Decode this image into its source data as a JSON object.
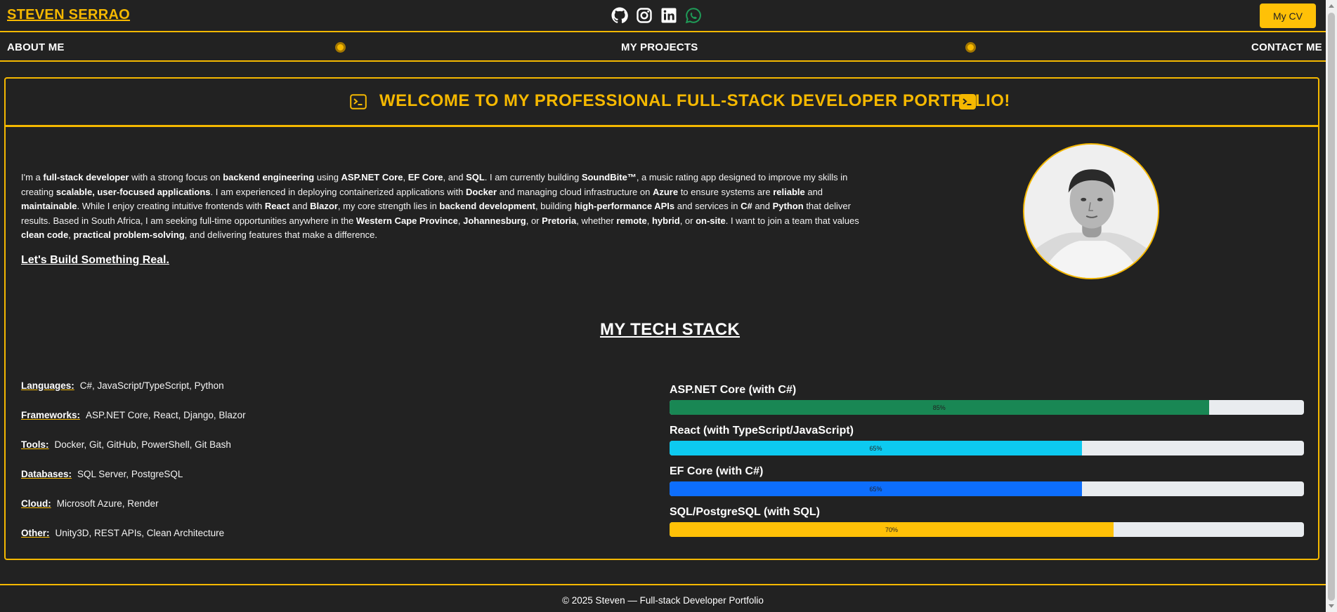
{
  "header": {
    "brand": "STEVEN SERRAO",
    "cv_button": "My CV",
    "socials": [
      {
        "icon": "github-icon"
      },
      {
        "icon": "instagram-icon"
      },
      {
        "icon": "linkedin-icon"
      },
      {
        "icon": "whatsapp-icon"
      }
    ]
  },
  "nav": {
    "about": "ABOUT ME",
    "projects": "MY PROJECTS",
    "contact": "CONTACT ME"
  },
  "welcome": {
    "title": "WELCOME TO MY PROFESSIONAL FULL-STACK DEVELOPER PORTFOLIO!"
  },
  "intro": {
    "p": [
      "I'm a ",
      {
        "b": "full-stack developer"
      },
      " with a strong focus on ",
      {
        "b": "backend engineering"
      },
      " using ",
      {
        "b": "ASP.NET Core"
      },
      ", ",
      {
        "b": "EF Core"
      },
      ", and ",
      {
        "b": "SQL"
      },
      ". I am currently building ",
      {
        "b": "SoundBite™"
      },
      ", a music rating app designed to improve my skills in creating ",
      {
        "b": "scalable, user-focused applications"
      },
      ". I am experienced in deploying containerized applications with ",
      {
        "b": "Docker"
      },
      " and managing cloud infrastructure on ",
      {
        "b": "Azure"
      },
      " to ensure systems are ",
      {
        "b": "reliable"
      },
      " and ",
      {
        "b": "maintainable"
      },
      ". While I enjoy creating intuitive frontends with ",
      {
        "b": "React"
      },
      " and ",
      {
        "b": "Blazor"
      },
      ", my core strength lies in ",
      {
        "b": "backend development"
      },
      ", building ",
      {
        "b": "high-performance APIs"
      },
      " and services in ",
      {
        "b": "C#"
      },
      " and ",
      {
        "b": "Python"
      },
      " that deliver results. Based in South Africa, I am seeking full-time opportunities anywhere in the ",
      {
        "b": "Western Cape Province"
      },
      ", ",
      {
        "b": "Johannesburg"
      },
      ", or ",
      {
        "b": "Pretoria"
      },
      ", whether ",
      {
        "b": "remote"
      },
      ", ",
      {
        "b": "hybrid"
      },
      ", or ",
      {
        "b": "on-site"
      },
      ". I want to join a team that values ",
      {
        "b": "clean code"
      },
      ", ",
      {
        "b": "practical problem-solving"
      },
      ", and delivering features that make a difference."
    ],
    "cta": "Let's Build Something Real."
  },
  "tech_stack": {
    "title": "MY TECH STACK",
    "rows": [
      {
        "key": "Languages:",
        "value": "C#, JavaScript/TypeScript, Python"
      },
      {
        "key": "Frameworks:",
        "value": "ASP.NET Core, React, Django, Blazor"
      },
      {
        "key": "Tools:",
        "value": "Docker, Git, GitHub, PowerShell, Git Bash"
      },
      {
        "key": "Databases:",
        "value": "SQL Server, PostgreSQL"
      },
      {
        "key": "Cloud:",
        "value": "Microsoft Azure, Render"
      },
      {
        "key": "Other:",
        "value": "Unity3D, REST APIs, Clean Architecture"
      }
    ],
    "skills": [
      {
        "label": "ASP.NET Core (with C#)",
        "percent": 85,
        "text": "85%",
        "color": "#198754"
      },
      {
        "label": "React (with TypeScript/JavaScript)",
        "percent": 65,
        "text": "65%",
        "color": "#0dcaf0"
      },
      {
        "label": "EF Core (with C#)",
        "percent": 65,
        "text": "65%",
        "color": "#0d6efd"
      },
      {
        "label": "SQL/PostgreSQL (with SQL)",
        "percent": 70,
        "text": "70%",
        "color": "#ffc107"
      }
    ]
  },
  "footer": {
    "text": "© 2025 Steven — Full-stack Developer Portfolio"
  },
  "colors": {
    "accent": "#f5b800",
    "background": "#222222"
  }
}
